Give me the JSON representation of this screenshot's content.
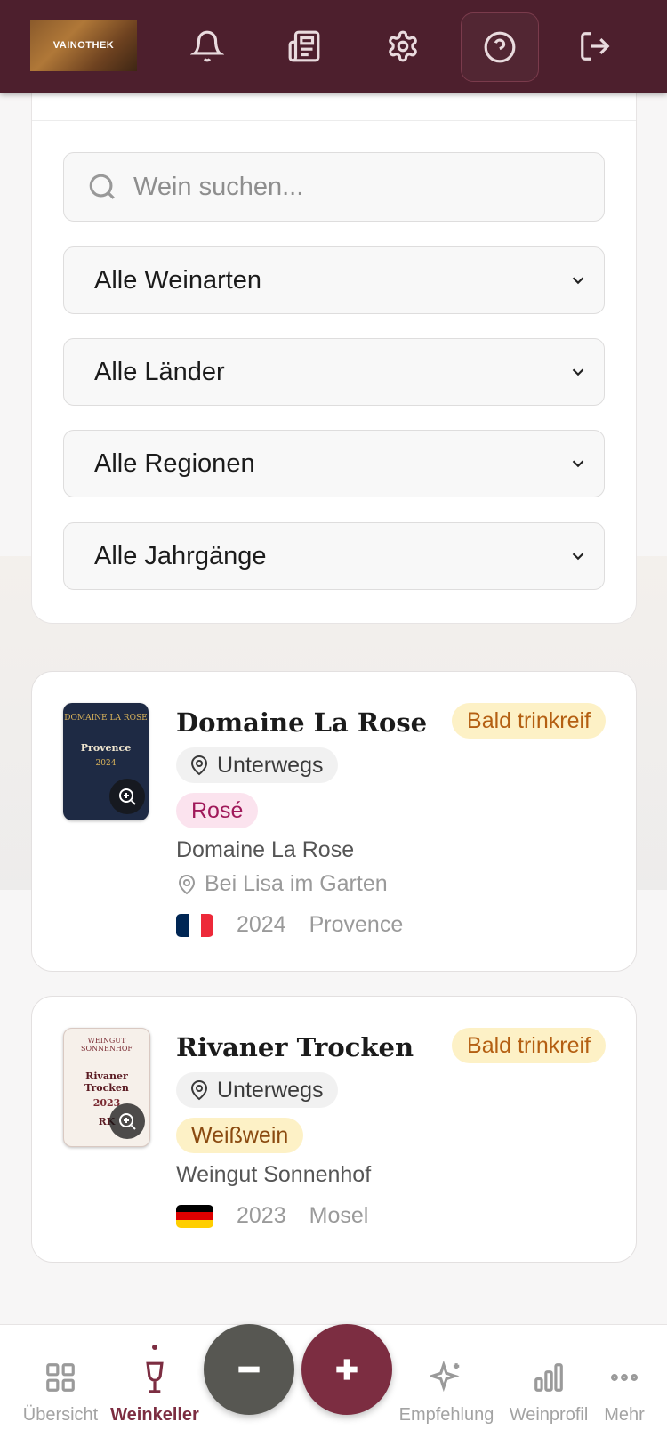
{
  "header": {
    "logo_text": "VAINOTHEK",
    "icons": [
      "bell-icon",
      "news-icon",
      "gear-icon",
      "help-icon",
      "logout-icon"
    ]
  },
  "filters": {
    "search_placeholder": "Wein suchen...",
    "wine_type": "Alle Weinarten",
    "country": "Alle Länder",
    "region": "Alle Regionen",
    "vintage": "Alle Jahrgänge"
  },
  "wines": [
    {
      "name": "Domaine La Rose",
      "status": "Bald trinkreif",
      "location": "Unterwegs",
      "type": "Rosé",
      "producer": "Domaine La Rose",
      "storage": "Bei Lisa im Garten",
      "year": "2024",
      "region": "Provence",
      "label_top": "DOMAINE LA ROSE",
      "label_mid": "Provence",
      "label_year": "2024"
    },
    {
      "name": "Rivaner Trocken",
      "status": "Bald trinkreif",
      "location": "Unterwegs",
      "type": "Weißwein",
      "producer": "Weingut Sonnenhof",
      "year": "2023",
      "region": "Mosel",
      "label_top": "WEINGUT SONNENHOF",
      "label_mid": "Rivaner Trocken",
      "label_year": "2023",
      "label_mono": "RK"
    }
  ],
  "nav": {
    "overview": "Übersicht",
    "cellar": "Weinkeller",
    "recommendation": "Empfehlung",
    "profile": "Weinprofil",
    "more": "Mehr"
  },
  "colors": {
    "header_bg": "#4d1f2d",
    "accent": "#7c2d41",
    "rose_badge_bg": "#fbe3ee",
    "rose_badge_text": "#a0195a",
    "white_badge_bg": "#fdf1c6",
    "white_badge_text": "#8a4a10",
    "minus_button": "#575752"
  }
}
